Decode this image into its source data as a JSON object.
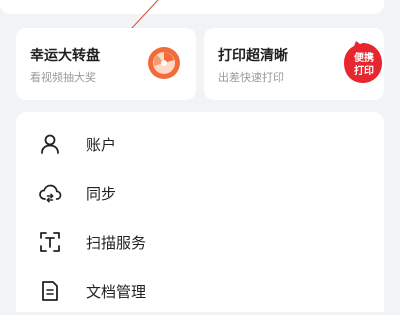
{
  "promos": [
    {
      "title": "幸运大转盘",
      "subtitle": "看视频抽大奖",
      "icon": "lucky-wheel-icon",
      "accent": "#f26b3a"
    },
    {
      "title": "打印超清晰",
      "subtitle": "出差快速打印",
      "badge": "便携打印",
      "accent": "#e8262d"
    }
  ],
  "menu": {
    "items": [
      {
        "label": "账户",
        "icon": "user-icon"
      },
      {
        "label": "同步",
        "icon": "cloud-sync-icon"
      },
      {
        "label": "扫描服务",
        "icon": "scan-text-icon"
      },
      {
        "label": "文档管理",
        "icon": "document-icon"
      }
    ]
  }
}
